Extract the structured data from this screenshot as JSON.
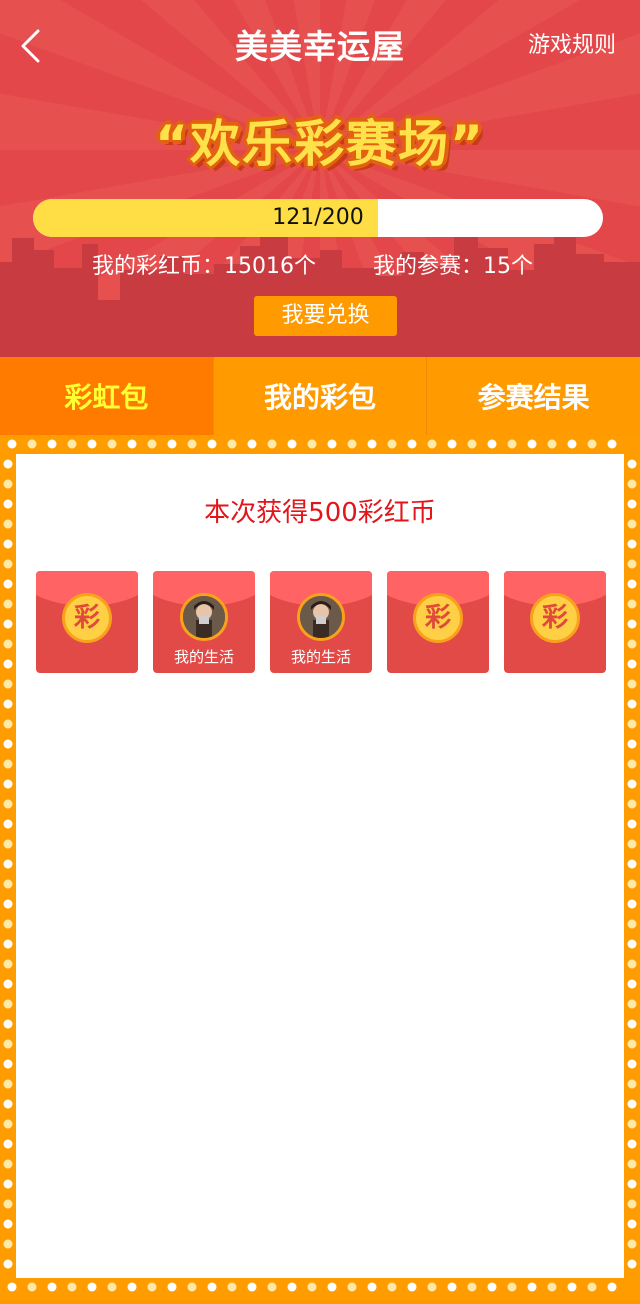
{
  "header": {
    "title": "美美幸运屋",
    "rules_link": "游戏规则",
    "back_icon": "chevron-left-icon"
  },
  "banner": {
    "title": "“欢乐彩赛场”",
    "progress": {
      "text": "121/200",
      "current": 121,
      "total": 200
    },
    "coins_label": "我的彩红币：15016个",
    "entries_label": "我的参赛：15个",
    "exchange_button": "我要兑换"
  },
  "tabs": [
    {
      "label": "彩虹包",
      "active": true
    },
    {
      "label": "我的彩包",
      "active": false
    },
    {
      "label": "参赛结果",
      "active": false
    }
  ],
  "result": {
    "message": "本次获得500彩红币"
  },
  "packets": [
    {
      "type": "coin",
      "coin_text": "彩"
    },
    {
      "type": "user",
      "name": "我的生活"
    },
    {
      "type": "user",
      "name": "我的生活"
    },
    {
      "type": "coin",
      "coin_text": "彩"
    },
    {
      "type": "coin",
      "coin_text": "彩"
    }
  ],
  "colors": {
    "hero_red": "#e3474a",
    "accent_orange": "#ff9a00",
    "active_tab": "#fe7b00",
    "progress_yellow": "#ffdd45",
    "result_red": "#e3151a"
  }
}
